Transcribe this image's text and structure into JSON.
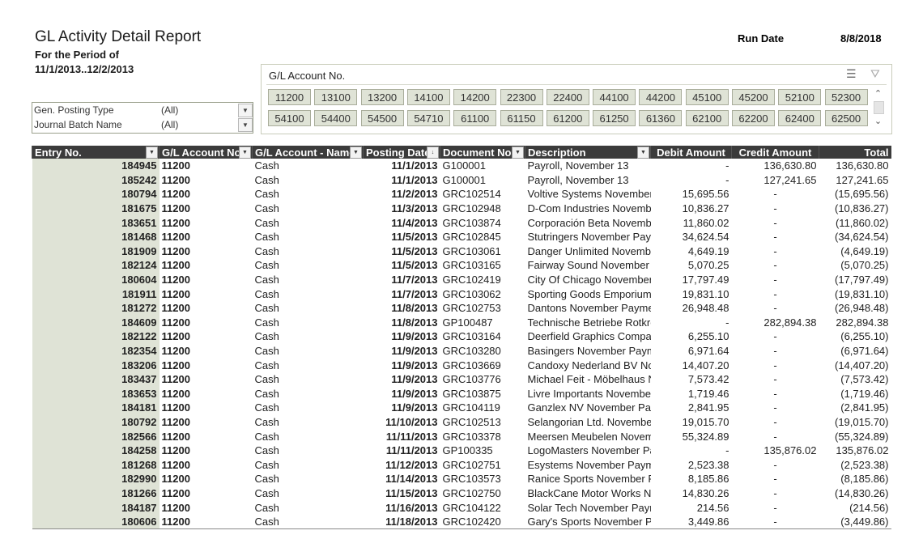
{
  "report": {
    "title": "GL Activity Detail Report",
    "period_label": "For the Period of",
    "period_value": "11/1/2013..12/2/2013",
    "run_date_label": "Run Date",
    "run_date_value": "8/8/2018"
  },
  "filters": [
    {
      "label": "Gen. Posting Type",
      "value": "(All)"
    },
    {
      "label": "Journal Batch Name",
      "value": "(All)"
    }
  ],
  "slicer": {
    "title": "G/L Account No.",
    "icons": [
      "multi-select-icon",
      "clear-filter-icon"
    ],
    "items": [
      "11200",
      "13100",
      "13200",
      "14100",
      "14200",
      "22300",
      "22400",
      "44100",
      "44200",
      "45100",
      "45200",
      "52100",
      "52300",
      "54100",
      "54400",
      "54500",
      "54710",
      "61100",
      "61150",
      "61200",
      "61250",
      "61360",
      "62100",
      "62200",
      "62400",
      "62500"
    ]
  },
  "table": {
    "headers": [
      "Entry No.",
      "G/L Account No.",
      "G/L Account - Name",
      "Posting Date",
      "Document No.",
      "Description",
      "Debit Amount",
      "Credit Amount",
      "Total"
    ],
    "rows": [
      [
        "184945",
        "11200",
        "Cash",
        "11/1/2013",
        "G100001",
        "Payroll, November 13",
        "-",
        "136,630.80",
        "136,630.80"
      ],
      [
        "185242",
        "11200",
        "Cash",
        "11/1/2013",
        "G100001",
        "Payroll, November 13",
        "-",
        "127,241.65",
        "127,241.65"
      ],
      [
        "180794",
        "11200",
        "Cash",
        "11/2/2013",
        "GRC102514",
        "Voltive Systems November",
        "15,695.56",
        "-",
        "(15,695.56)"
      ],
      [
        "181675",
        "11200",
        "Cash",
        "11/3/2013",
        "GRC102948",
        "D-Com Industries November",
        "10,836.27",
        "-",
        "(10,836.27)"
      ],
      [
        "183651",
        "11200",
        "Cash",
        "11/4/2013",
        "GRC103874",
        "Corporación Beta November",
        "11,860.02",
        "-",
        "(11,860.02)"
      ],
      [
        "181468",
        "11200",
        "Cash",
        "11/5/2013",
        "GRC102845",
        "Stutringers November Payment",
        "34,624.54",
        "-",
        "(34,624.54)"
      ],
      [
        "181909",
        "11200",
        "Cash",
        "11/5/2013",
        "GRC103061",
        "Danger Unlimited November",
        "4,649.19",
        "-",
        "(4,649.19)"
      ],
      [
        "182124",
        "11200",
        "Cash",
        "11/5/2013",
        "GRC103165",
        "Fairway Sound November Payment",
        "5,070.25",
        "-",
        "(5,070.25)"
      ],
      [
        "180604",
        "11200",
        "Cash",
        "11/7/2013",
        "GRC102419",
        "City Of Chicago November Payment",
        "17,797.49",
        "-",
        "(17,797.49)"
      ],
      [
        "181911",
        "11200",
        "Cash",
        "11/7/2013",
        "GRC103062",
        "Sporting Goods Emporium",
        "19,831.10",
        "-",
        "(19,831.10)"
      ],
      [
        "181272",
        "11200",
        "Cash",
        "11/8/2013",
        "GRC102753",
        "Dantons November Payment",
        "26,948.48",
        "-",
        "(26,948.48)"
      ],
      [
        "184609",
        "11200",
        "Cash",
        "11/8/2013",
        "GP100487",
        "Technische Betriebe Rotkreuz",
        "-",
        "282,894.38",
        "282,894.38"
      ],
      [
        "182122",
        "11200",
        "Cash",
        "11/9/2013",
        "GRC103164",
        "Deerfield Graphics Company",
        "6,255.10",
        "-",
        "(6,255.10)"
      ],
      [
        "182354",
        "11200",
        "Cash",
        "11/9/2013",
        "GRC103280",
        "Basingers November Payment",
        "6,971.64",
        "-",
        "(6,971.64)"
      ],
      [
        "183206",
        "11200",
        "Cash",
        "11/9/2013",
        "GRC103669",
        "Candoxy Nederland BV November",
        "14,407.20",
        "-",
        "(14,407.20)"
      ],
      [
        "183437",
        "11200",
        "Cash",
        "11/9/2013",
        "GRC103776",
        "Michael Feit - Möbelhaus November",
        "7,573.42",
        "-",
        "(7,573.42)"
      ],
      [
        "183653",
        "11200",
        "Cash",
        "11/9/2013",
        "GRC103875",
        "Livre Importants November",
        "1,719.46",
        "-",
        "(1,719.46)"
      ],
      [
        "184181",
        "11200",
        "Cash",
        "11/9/2013",
        "GRC104119",
        "Ganzlex NV November Payment",
        "2,841.95",
        "-",
        "(2,841.95)"
      ],
      [
        "180792",
        "11200",
        "Cash",
        "11/10/2013",
        "GRC102513",
        "Selangorian Ltd. November",
        "19,015.70",
        "-",
        "(19,015.70)"
      ],
      [
        "182566",
        "11200",
        "Cash",
        "11/11/2013",
        "GRC103378",
        "Meersen Meubelen November",
        "55,324.89",
        "-",
        "(55,324.89)"
      ],
      [
        "184258",
        "11200",
        "Cash",
        "11/11/2013",
        "GP100335",
        "LogoMasters November Payment",
        "-",
        "135,876.02",
        "135,876.02"
      ],
      [
        "181268",
        "11200",
        "Cash",
        "11/12/2013",
        "GRC102751",
        "Esystems November Payment",
        "2,523.38",
        "-",
        "(2,523.38)"
      ],
      [
        "182990",
        "11200",
        "Cash",
        "11/14/2013",
        "GRC103573",
        "Ranice Sports November Payment",
        "8,185.86",
        "-",
        "(8,185.86)"
      ],
      [
        "181266",
        "11200",
        "Cash",
        "11/15/2013",
        "GRC102750",
        "BlackCane Motor Works November",
        "14,830.26",
        "-",
        "(14,830.26)"
      ],
      [
        "184187",
        "11200",
        "Cash",
        "11/16/2013",
        "GRC104122",
        "Solar Tech November Payment",
        "214.56",
        "-",
        "(214.56)"
      ],
      [
        "180606",
        "11200",
        "Cash",
        "11/18/2013",
        "GRC102420",
        "Gary's Sports November Payment",
        "3,449.86",
        "-",
        "(3,449.86)"
      ]
    ]
  },
  "colors": {
    "header_bg": "#3b3b3b",
    "slicer_button": "#dfe3d6",
    "entry_shade": "#dfe3d6"
  }
}
